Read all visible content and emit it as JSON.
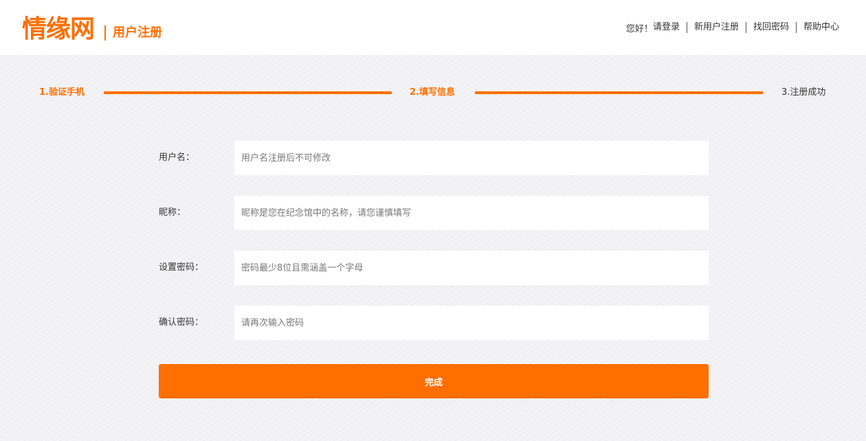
{
  "brand": {
    "logo_text": "情缘网",
    "subtitle": "用户注册",
    "accent_color": "#ff6e00"
  },
  "top_nav": {
    "greeting": "您好！",
    "links": [
      "请登录",
      "新用户注册",
      "找回密码",
      "帮助中心"
    ]
  },
  "steps": [
    {
      "label": "1.验证手机",
      "state": "completed"
    },
    {
      "label": "2.填写信息",
      "state": "current"
    },
    {
      "label": "3.注册成功",
      "state": "pending"
    }
  ],
  "form": {
    "fields": [
      {
        "label": "用户名：",
        "placeholder": "用户名注册后不可修改",
        "value": ""
      },
      {
        "label": "昵称：",
        "placeholder": "昵称是您在纪念馆中的名称，请您谨慎填写",
        "value": ""
      },
      {
        "label": "设置密码：",
        "placeholder": "密码最少8位且需涵盖一个字母",
        "value": ""
      },
      {
        "label": "确认密码：",
        "placeholder": "请再次输入密码",
        "value": ""
      }
    ],
    "submit_label": "完成"
  }
}
